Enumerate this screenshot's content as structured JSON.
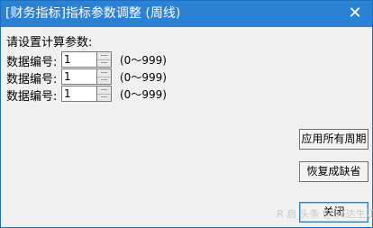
{
  "window": {
    "title": "[财务指标]指标参数调整 (周线)",
    "close_glyph": "✕"
  },
  "form": {
    "prompt": "请设置计算参数:",
    "params": [
      {
        "label": "数据编号:",
        "value": "1",
        "range": "(0～999)"
      },
      {
        "label": "数据编号:",
        "value": "1",
        "range": "(0～999)"
      },
      {
        "label": "数据编号:",
        "value": "1",
        "range": "(0～999)"
      }
    ]
  },
  "buttons": {
    "apply_all": "应用所有周期",
    "restore_default": "恢复成缺省",
    "close": "关闭"
  },
  "watermark": {
    "text": "R 启 头条 @ 兴达生江"
  },
  "colors": {
    "title_bar": "#2b82d4",
    "client_bg": "#f0f0f0"
  }
}
